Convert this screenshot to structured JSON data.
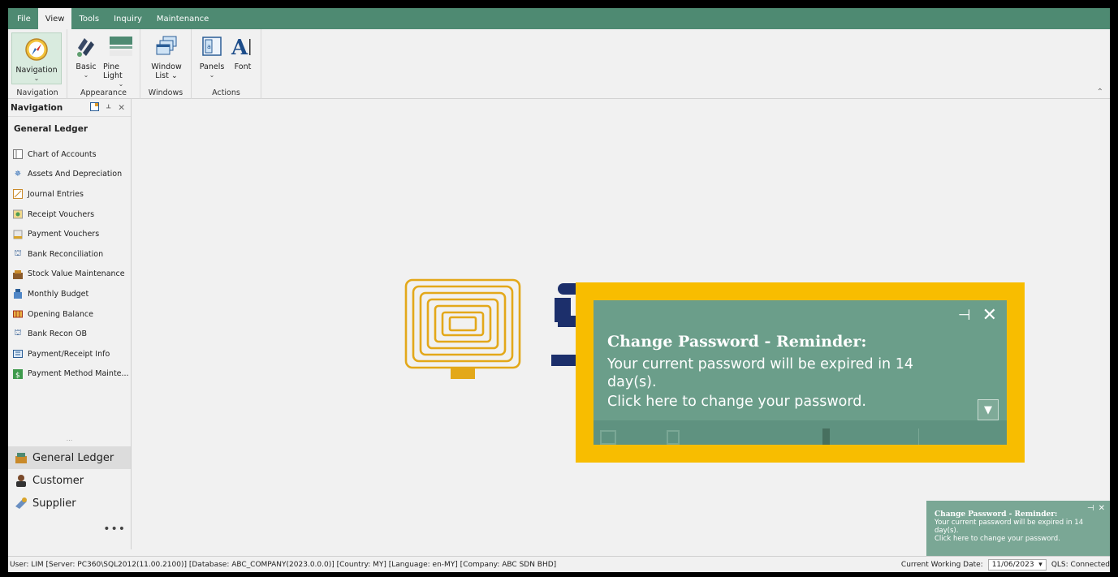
{
  "menubar": {
    "items": [
      "File",
      "View",
      "Tools",
      "Inquiry",
      "Maintenance"
    ],
    "active_index": 1
  },
  "ribbon": {
    "groups": {
      "navigation": {
        "label": "Navigation",
        "buttons": [
          {
            "label": "Navigation",
            "icon": "compass-icon"
          }
        ]
      },
      "appearance": {
        "label": "Appearance",
        "buttons": [
          {
            "label": "Basic",
            "icon": "palette-icon"
          },
          {
            "label": "Pine Light",
            "icon": "theme-swatch-icon"
          }
        ]
      },
      "windows": {
        "label": "Windows",
        "buttons": [
          {
            "label": "Window List",
            "line1": "Window",
            "line2": "List",
            "icon": "stacked-windows-icon"
          }
        ]
      },
      "actions": {
        "label": "Actions",
        "buttons": [
          {
            "label": "Panels",
            "icon": "panels-icon"
          },
          {
            "label": "Font",
            "icon": "font-icon"
          }
        ]
      }
    }
  },
  "nav": {
    "header": "Navigation",
    "title": "General Ledger",
    "items": [
      {
        "label": "Chart of Accounts",
        "icon": "chart-of-accounts-icon"
      },
      {
        "label": "Assets And Depreciation",
        "icon": "gear-icon"
      },
      {
        "label": "Journal Entries",
        "icon": "journal-icon"
      },
      {
        "label": "Receipt Vouchers",
        "icon": "receipt-icon"
      },
      {
        "label": "Payment Vouchers",
        "icon": "payment-icon"
      },
      {
        "label": "Bank Reconciliation",
        "icon": "bank-icon"
      },
      {
        "label": "Stock Value Maintenance",
        "icon": "stock-icon"
      },
      {
        "label": "Monthly Budget",
        "icon": "budget-icon"
      },
      {
        "label": "Opening Balance",
        "icon": "opening-balance-icon"
      },
      {
        "label": "Bank Recon OB",
        "icon": "bank-icon"
      },
      {
        "label": "Payment/Receipt Info",
        "icon": "info-card-icon"
      },
      {
        "label": "Payment Method Mainte...",
        "icon": "dollar-icon"
      }
    ],
    "dots": "...",
    "bottom": [
      {
        "label": "General Ledger",
        "icon": "ledger-icon",
        "selected": true
      },
      {
        "label": "Customer",
        "icon": "customer-icon"
      },
      {
        "label": "Supplier",
        "icon": "supplier-icon"
      }
    ],
    "more": "•••"
  },
  "callout": {
    "title": "Change Password - Reminder:",
    "message_line1": "Your current password will be expired in 14 day(s).",
    "message_line2": "Click here to change your password."
  },
  "toast": {
    "title": "Change Password - Reminder:",
    "message_line1": "Your current password will be expired in 14 day(s).",
    "message_line2": "Click here to change your password."
  },
  "statusbar": {
    "info": "User: LIM  [Server: PC360\\SQL2012(11.00.2100)]  [Database: ABC_COMPANY(2023.0.0.0)]  [Country: MY]  [Language: en-MY]  [Company: ABC SDN BHD]",
    "date_label": "Current Working Date:",
    "date_value": "11/06/2023",
    "qls": "QLS: Connected"
  },
  "colors": {
    "menubar": "#4e8a72",
    "toast": "#7aa795",
    "callout_border": "#f8bd00",
    "logo_gold": "#e3a81a",
    "logo_navy": "#1c2f6b"
  }
}
